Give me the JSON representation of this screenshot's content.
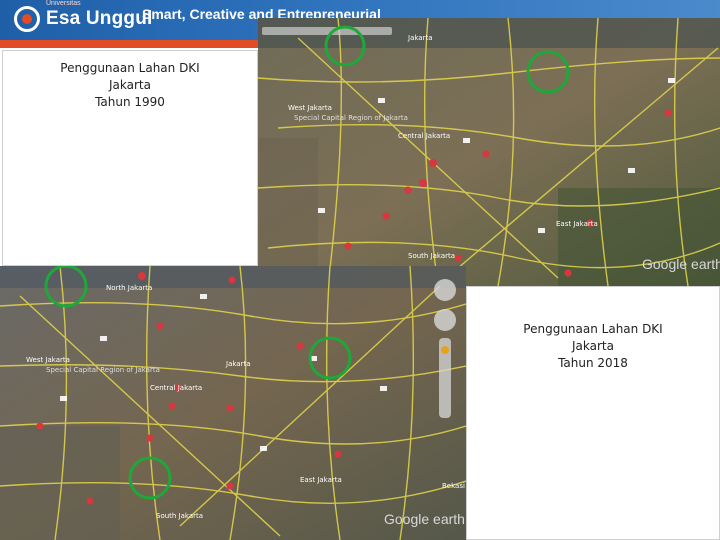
{
  "header": {
    "logo_text": "Esa Unggul",
    "logo_subtext": "Universitas",
    "tagline": "Smart, Creative and Entrepreneurial",
    "brand_color": "#1f5fa8",
    "accent_color": "#e14b25"
  },
  "captions": {
    "map_1990": {
      "line1": "Penggunaan Lahan DKI",
      "line2": "Jakarta",
      "line3": "Tahun 1990"
    },
    "map_2018": {
      "line1": "Penggunaan Lahan DKI",
      "line2": "Jakarta",
      "line3": "Tahun 2018"
    }
  },
  "map_1990": {
    "places": [
      "Jakarta",
      "West Jakarta",
      "Special Capital Region of Jakarta",
      "Central Jakarta",
      "East Jakarta",
      "South Jakarta"
    ],
    "watermark": "Google earth",
    "highlight_color": "#1fa83a"
  },
  "map_2018": {
    "places": [
      "North Jakarta",
      "West Jakarta",
      "Special Capital Region of Jakarta",
      "Central Jakarta",
      "Jakarta",
      "East Jakarta",
      "South Jakarta",
      "Bekasi"
    ],
    "watermark": "Google earth",
    "highlight_color": "#1fa83a"
  }
}
